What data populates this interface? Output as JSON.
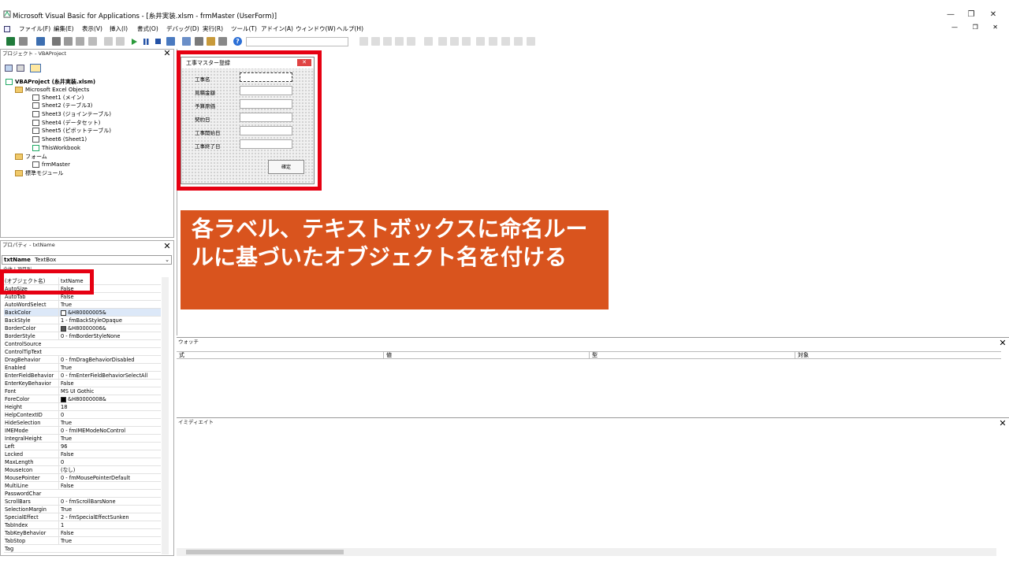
{
  "window": {
    "title": "Microsoft Visual Basic for Applications - [糸井実装.xlsm - frmMaster (UserForm)]",
    "min": "—",
    "restore": "❐",
    "close": "✕"
  },
  "menu": [
    "ファイル(F)",
    "編集(E)",
    "表示(V)",
    "挿入(I)",
    "書式(O)",
    "デバッグ(D)",
    "実行(R)",
    "ツール(T)",
    "アドイン(A)",
    "ウィンドウ(W)",
    "ヘルプ(H)"
  ],
  "mdi_controls": "— ❐ ✕",
  "project": {
    "header": "プロジェクト - VBAProject",
    "tree": {
      "root": "VBAProject (糸井実装.xlsm)",
      "objects_folder": "Microsoft Excel Objects",
      "sheets": [
        "Sheet1 (メイン)",
        "Sheet2 (テーブル3)",
        "Sheet3 (ジョインテーブル)",
        "Sheet4 (データセット)",
        "Sheet5 (ピボットテーブル)",
        "Sheet6 (Sheet1)",
        "ThisWorkbook"
      ],
      "forms_folder": "フォーム",
      "form": "frmMaster",
      "modules_folder": "標準モジュール"
    }
  },
  "properties": {
    "header": "プロパティ - txtName",
    "object_name": "txtName",
    "object_type": "TextBox",
    "tabs": "全体 | 項目別",
    "rows": [
      {
        "k": "(オブジェクト名)",
        "v": "txtName"
      },
      {
        "k": "AutoSize",
        "v": "False"
      },
      {
        "k": "AutoTab",
        "v": "False"
      },
      {
        "k": "AutoWordSelect",
        "v": "True"
      },
      {
        "k": "BackColor",
        "v": "&H80000005&"
      },
      {
        "k": "BackStyle",
        "v": "1 - fmBackStyleOpaque"
      },
      {
        "k": "BorderColor",
        "v": "&H80000006&"
      },
      {
        "k": "BorderStyle",
        "v": "0 - fmBorderStyleNone"
      },
      {
        "k": "ControlSource",
        "v": ""
      },
      {
        "k": "ControlTipText",
        "v": ""
      },
      {
        "k": "DragBehavior",
        "v": "0 - fmDragBehaviorDisabled"
      },
      {
        "k": "Enabled",
        "v": "True"
      },
      {
        "k": "EnterFieldBehavior",
        "v": "0 - fmEnterFieldBehaviorSelectAll"
      },
      {
        "k": "EnterKeyBehavior",
        "v": "False"
      },
      {
        "k": "Font",
        "v": "MS UI Gothic"
      },
      {
        "k": "ForeColor",
        "v": "&H80000008&"
      },
      {
        "k": "Height",
        "v": "18"
      },
      {
        "k": "HelpContextID",
        "v": "0"
      },
      {
        "k": "HideSelection",
        "v": "True"
      },
      {
        "k": "IMEMode",
        "v": "0 - fmIMEModeNoControl"
      },
      {
        "k": "IntegralHeight",
        "v": "True"
      },
      {
        "k": "Left",
        "v": "96"
      },
      {
        "k": "Locked",
        "v": "False"
      },
      {
        "k": "MaxLength",
        "v": "0"
      },
      {
        "k": "MouseIcon",
        "v": "(なし)"
      },
      {
        "k": "MousePointer",
        "v": "0 - fmMousePointerDefault"
      },
      {
        "k": "MultiLine",
        "v": "False"
      },
      {
        "k": "PasswordChar",
        "v": ""
      },
      {
        "k": "ScrollBars",
        "v": "0 - fmScrollBarsNone"
      },
      {
        "k": "SelectionMargin",
        "v": "True"
      },
      {
        "k": "SpecialEffect",
        "v": "2 - fmSpecialEffectSunken"
      },
      {
        "k": "TabIndex",
        "v": "1"
      },
      {
        "k": "TabKeyBehavior",
        "v": "False"
      },
      {
        "k": "TabStop",
        "v": "True"
      },
      {
        "k": "Tag",
        "v": ""
      }
    ]
  },
  "userform": {
    "caption": "工事マスター登録",
    "labels": [
      "工事名",
      "見積金額",
      "予算原価",
      "契約日",
      "工事開始日",
      "工事終了日"
    ],
    "button": "確定",
    "close": "✕"
  },
  "callout": {
    "text": "各ラベル、テキストボックスに命名ルールに基づいたオブジェクト名を付ける",
    "color": "#d9541e"
  },
  "highlight_color": "#e60012",
  "watch": {
    "header": "ウォッチ",
    "columns": [
      "式",
      "値",
      "型",
      "対象"
    ]
  },
  "immediate": {
    "header": "イミディエイト"
  }
}
